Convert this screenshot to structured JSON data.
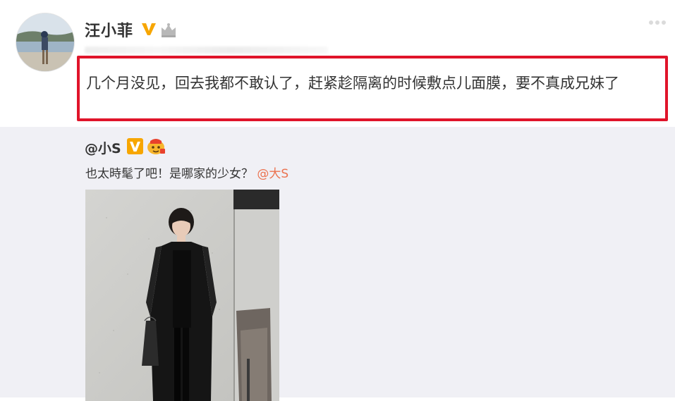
{
  "post": {
    "username": "汪小菲",
    "text": "几个月没见，回去我都不敢认了，赶紧趁隔离的时候敷点儿面膜，要不真成兄妹了"
  },
  "repost": {
    "username": "@小S",
    "text": "也太時髦了吧！是哪家的少女？",
    "mention": "@大S"
  },
  "colors": {
    "highlight_border": "#e0142a",
    "mention": "#eb7350",
    "verified_badge": "#f7a600",
    "repost_background": "#f0f0f5"
  },
  "icons": [
    "avatar",
    "verified-v-icon",
    "crown-icon",
    "more-options-icon",
    "verified-v-icon",
    "emoji-icon"
  ]
}
